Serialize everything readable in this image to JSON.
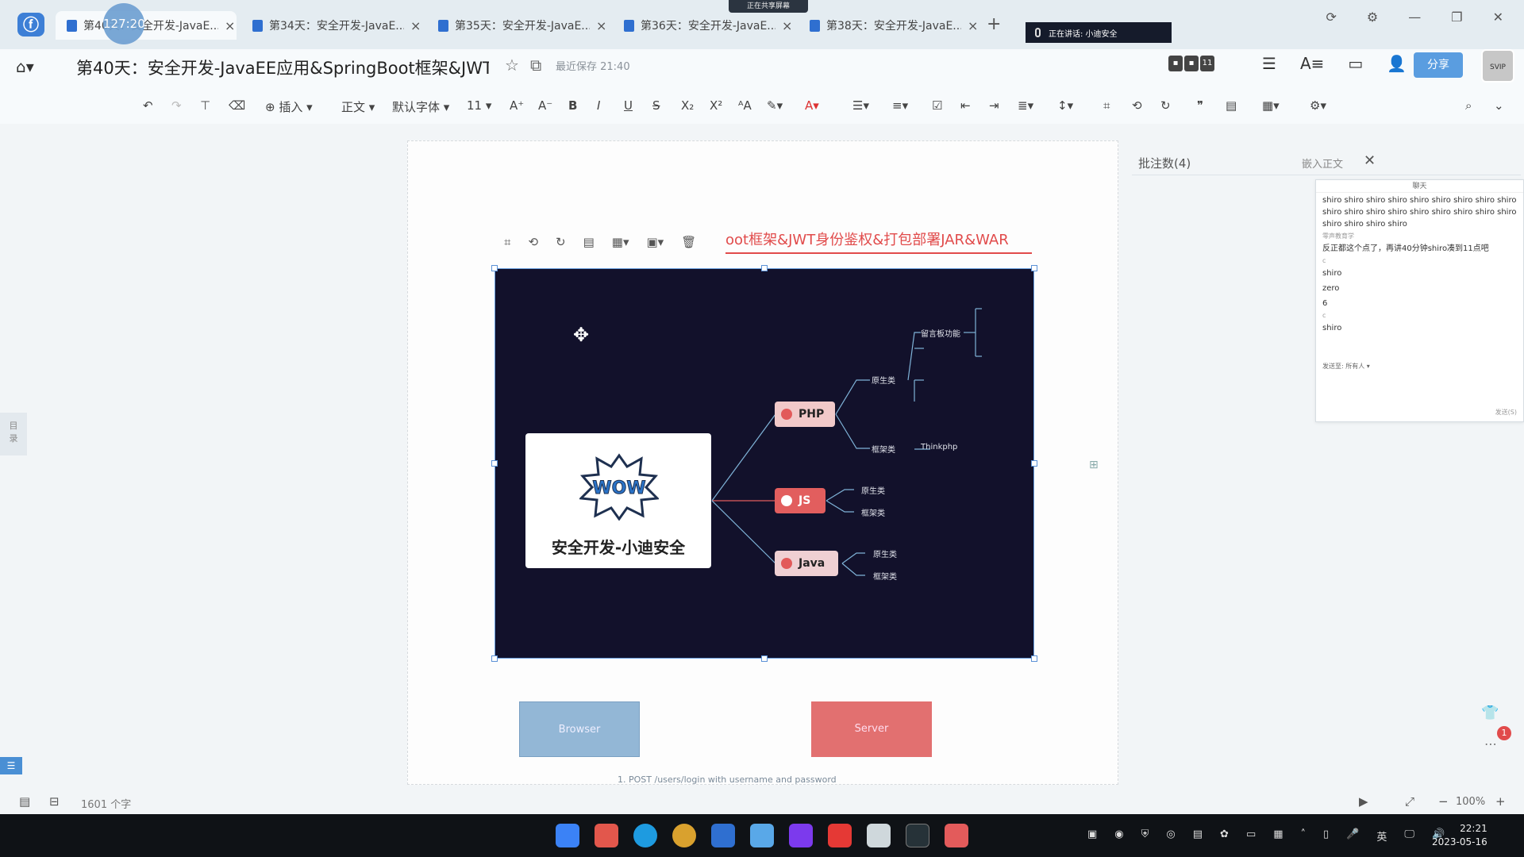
{
  "tabs": [
    {
      "label": "第40天：安全开发-JavaE..."
    },
    {
      "label": "第34天：安全开发-JavaE..."
    },
    {
      "label": "第35天：安全开发-JavaE..."
    },
    {
      "label": "第36天：安全开发-JavaE..."
    },
    {
      "label": "第38天：安全开发-JavaE..."
    }
  ],
  "overlay": {
    "timer": "127:20",
    "share_banner": "正在共享屏幕",
    "speaking": "正在讲话: 小迪安全"
  },
  "title": {
    "doc_title": "第40天：安全开发-JavaEE应用&SpringBoot框架&JWT...",
    "save_status": "最近保存 21:40",
    "share_button": "分享",
    "avatar_count": "11",
    "user_badge": "SVIP"
  },
  "toolbar": {
    "insert": "插入",
    "style": "正文",
    "font": "默认字体",
    "size": "11"
  },
  "document": {
    "heading_fragment": "oot框架&JWT身份鉴权&打包部署JAR&WAR",
    "mindmap": {
      "center": "安全开发-小迪安全",
      "wow": "WOW",
      "php": "PHP",
      "js": "JS",
      "java": "Java",
      "php_native": "原生类",
      "php_native_guestbook": "留言板功能",
      "php_framework": "框架类",
      "thinkphp": "Thinkphp",
      "js_native": "原生类",
      "js_framework": "框架类",
      "java_native": "原生类",
      "java_framework": "框架类"
    },
    "browser_label": "Browser",
    "server_label": "Server",
    "arrow_label": "1. POST /users/login with username and password"
  },
  "comments": {
    "title": "批注数(4)",
    "embed": "嵌入正文",
    "chat_title": "聊天",
    "messages": [
      "shiro shiro shiro shiro shiro shiro shiro shiro shiro shiro shiro shiro shiro shiro shiro shiro shiro shiro shiro shiro shiro shiro",
      "反正都这个点了，再讲40分钟shiro凑到11点吧",
      "shiro",
      "zero",
      "6",
      "shiro"
    ],
    "subs": [
      "零声教育学",
      "c",
      "c"
    ],
    "send_to": "发送至:",
    "send_target": "所有人",
    "send_btn": "发送(S)"
  },
  "status": {
    "word_count": "1601 个字",
    "zoom": "100%"
  },
  "clock": {
    "time": "22:21",
    "date": "2023-05-16",
    "ime": "英"
  },
  "notif_count": "1"
}
